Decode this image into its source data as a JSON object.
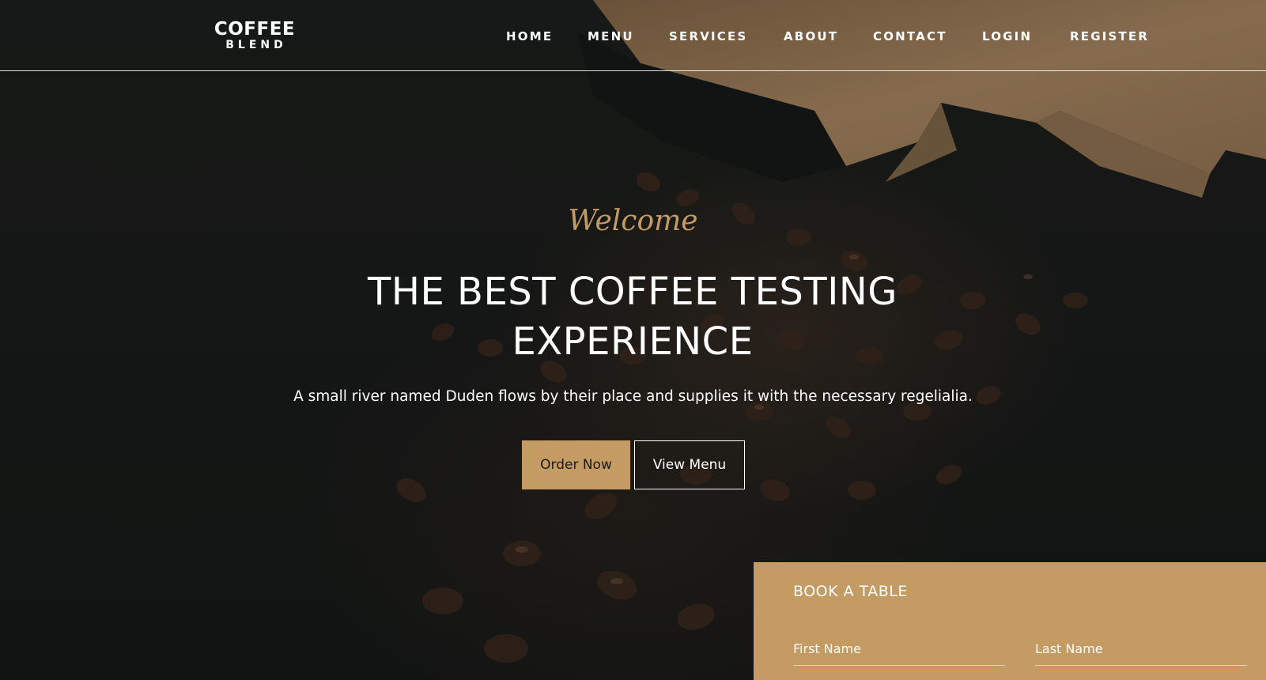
{
  "brand": {
    "logo_top": "COFFEE",
    "logo_bottom": "BLEND"
  },
  "nav": {
    "items": [
      "HOME",
      "MENU",
      "SERVICES",
      "ABOUT",
      "CONTACT",
      "LOGIN",
      "REGISTER"
    ]
  },
  "hero": {
    "welcome": "Welcome",
    "title": "THE BEST COFFEE TESTING EXPERIENCE",
    "subtitle": "A small river named Duden flows by their place and supplies it with the necessary regelialia.",
    "primary_button": "Order Now",
    "secondary_button": "View Menu"
  },
  "booking": {
    "title": "BOOK A TABLE",
    "first_name_placeholder": "First Name",
    "last_name_placeholder": "Last Name"
  },
  "colors": {
    "accent": "#c49b63",
    "background": "#1a1c1b",
    "text": "#ffffff"
  }
}
